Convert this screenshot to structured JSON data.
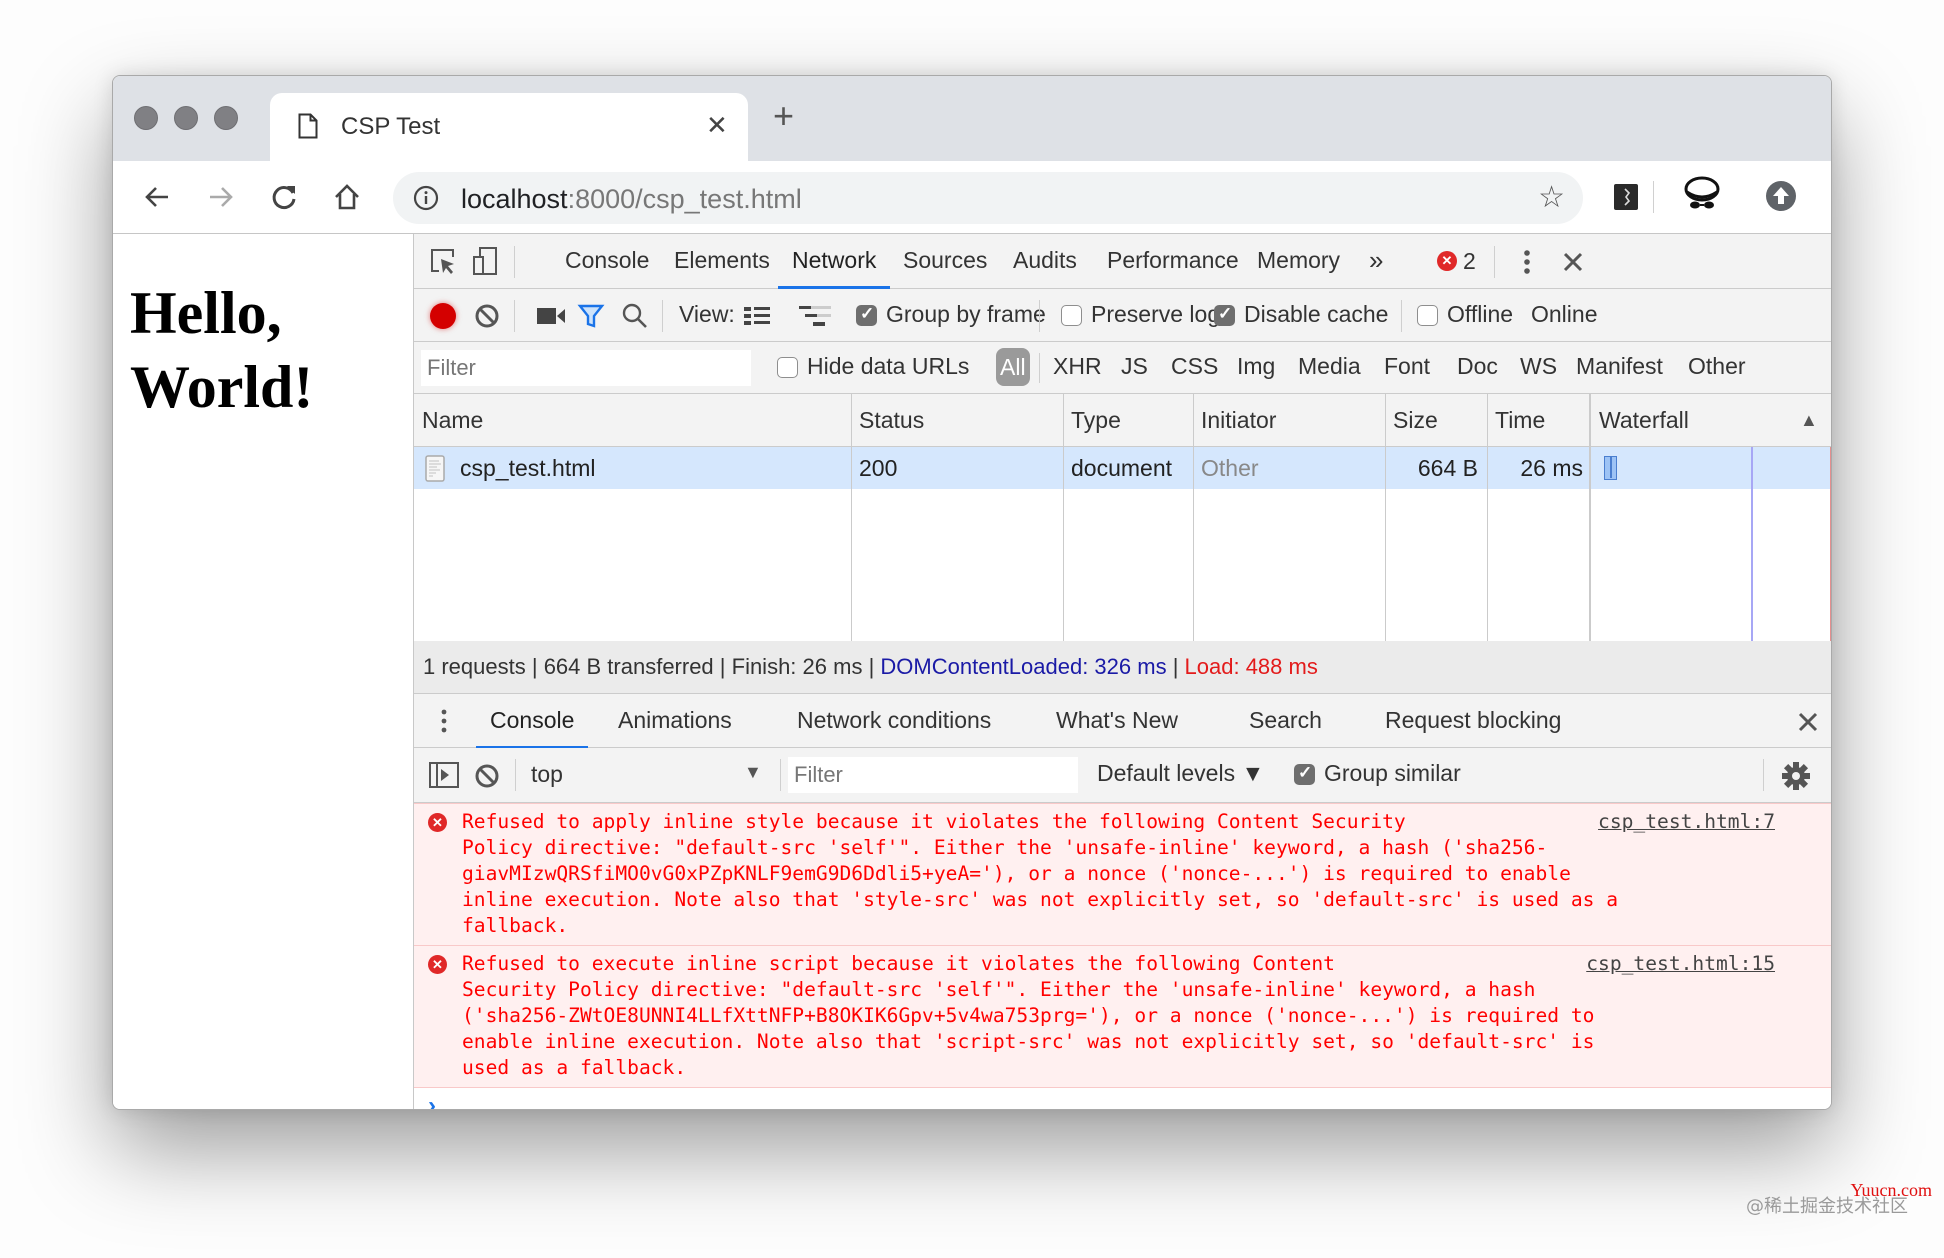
{
  "window": {
    "tab_title": "CSP Test",
    "new_tab_label": "+",
    "address": {
      "host": "localhost",
      "rest": ":8000/csp_test.html"
    }
  },
  "page": {
    "heading_line1": "Hello,",
    "heading_line2": "World!"
  },
  "devtools": {
    "tabs": [
      "Console",
      "Elements",
      "Network",
      "Sources",
      "Audits",
      "Performance",
      "Memory"
    ],
    "active_tab": "Network",
    "more_tabs": "»",
    "error_count": "2",
    "network_toolbar": {
      "view_label": "View:",
      "group_by_frame": {
        "label": "Group by frame",
        "checked": true
      },
      "preserve_log": {
        "label": "Preserve log",
        "checked": false
      },
      "disable_cache": {
        "label": "Disable cache",
        "checked": true
      },
      "offline": {
        "label": "Offline",
        "checked": false
      },
      "throttling": "Online"
    },
    "filter_bar": {
      "filter_placeholder": "Filter",
      "hide_data_urls": {
        "label": "Hide data URLs",
        "checked": false
      },
      "types": [
        "All",
        "XHR",
        "JS",
        "CSS",
        "Img",
        "Media",
        "Font",
        "Doc",
        "WS",
        "Manifest",
        "Other"
      ],
      "active_type": "All"
    },
    "table": {
      "columns": [
        "Name",
        "Status",
        "Type",
        "Initiator",
        "Size",
        "Time",
        "Waterfall"
      ],
      "sort_indicator": "▲",
      "rows": [
        {
          "name": "csp_test.html",
          "status": "200",
          "type": "document",
          "initiator": "Other",
          "size": "664 B",
          "time": "26 ms"
        }
      ]
    },
    "summary": {
      "requests": "1 requests",
      "transferred": "664 B transferred",
      "finish": "Finish: 26 ms",
      "dom_content_loaded": "DOMContentLoaded: 326 ms",
      "load": "Load: 488 ms",
      "sep": " | ",
      "dcl_color": "#1a1aa6",
      "load_color": "#e31b1b"
    },
    "drawer": {
      "tabs": [
        "Console",
        "Animations",
        "Network conditions",
        "What's New",
        "Search",
        "Request blocking"
      ],
      "active_tab": "Console",
      "context": "top",
      "filter_placeholder": "Filter",
      "levels": "Default levels ▼",
      "group_similar": {
        "label": "Group similar",
        "checked": true
      }
    },
    "console_messages": [
      {
        "level": "error",
        "text": "Refused to apply inline style because it violates the following Content Security\nPolicy directive: \"default-src 'self'\". Either the 'unsafe-inline' keyword, a hash ('sha256-\ngiavMIzwQRSfiMO0vG0xPZpKNLF9emG9D6Ddli5+yeA='), or a nonce ('nonce-...') is required to enable\ninline execution. Note also that 'style-src' was not explicitly set, so 'default-src' is used as a\nfallback.",
        "source": "csp_test.html:7"
      },
      {
        "level": "error",
        "text": "Refused to execute inline script because it violates the following Content\nSecurity Policy directive: \"default-src 'self'\". Either the 'unsafe-inline' keyword, a hash\n('sha256-ZWtOE8UNNI4LLfXttNFP+B8OKIK6Gpv+5v4wa753prg='), or a nonce ('nonce-...') is required to\nenable inline execution. Note also that 'script-src' was not explicitly set, so 'default-src' is\nused as a fallback.",
        "source": "csp_test.html:15"
      }
    ],
    "prompt_symbol": "›"
  },
  "watermark": {
    "text": "@稀土掘金技术社区",
    "brand": "Yuucn.com"
  }
}
